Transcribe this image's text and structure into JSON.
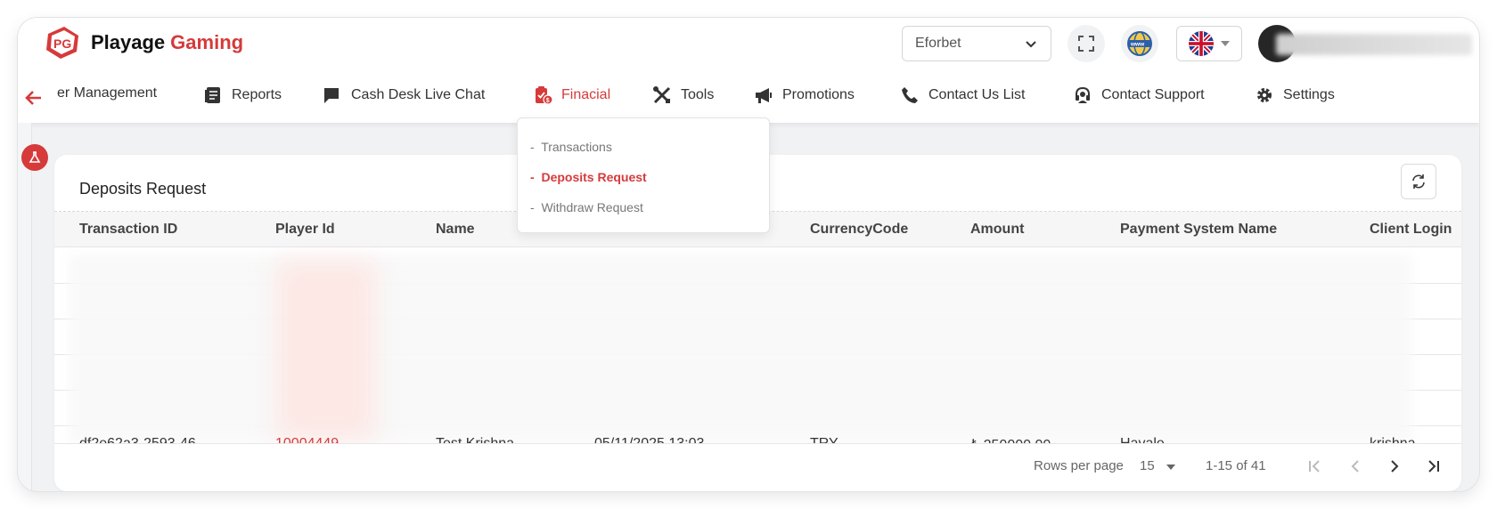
{
  "brand": {
    "word1": "Playage",
    "word2": "Gaming"
  },
  "header": {
    "site_select_value": "Eforbet"
  },
  "nav": {
    "items": [
      {
        "label": "er Management"
      },
      {
        "label": "Reports"
      },
      {
        "label": "Cash Desk Live Chat"
      },
      {
        "label": "Finacial"
      },
      {
        "label": "Tools"
      },
      {
        "label": "Promotions"
      },
      {
        "label": "Contact Us List"
      },
      {
        "label": "Contact Support"
      },
      {
        "label": "Settings"
      }
    ]
  },
  "dropdown": {
    "items": [
      {
        "label": "Transactions"
      },
      {
        "label": "Deposits Request"
      },
      {
        "label": "Withdraw Request"
      }
    ]
  },
  "card": {
    "title": "Deposits Request"
  },
  "table": {
    "columns": [
      "Transaction ID",
      "Player Id",
      "Name",
      "CurrencyCode",
      "Amount",
      "Payment System Name",
      "Client Login"
    ],
    "last_row": {
      "transaction_id": "df2e62a3-2593-46",
      "player_id": "10004449",
      "name": "Test Krishna",
      "date": "05/11/2025 13:03",
      "currency": "TRY",
      "amount": "₺ 250000.00",
      "payment_system": "Havale",
      "client_login": "krishna"
    }
  },
  "pagination": {
    "rows_per_page_label": "Rows per page",
    "rows_per_page_value": "15",
    "range": "1-15 of 41"
  },
  "colors": {
    "accent": "#d63a3a"
  }
}
